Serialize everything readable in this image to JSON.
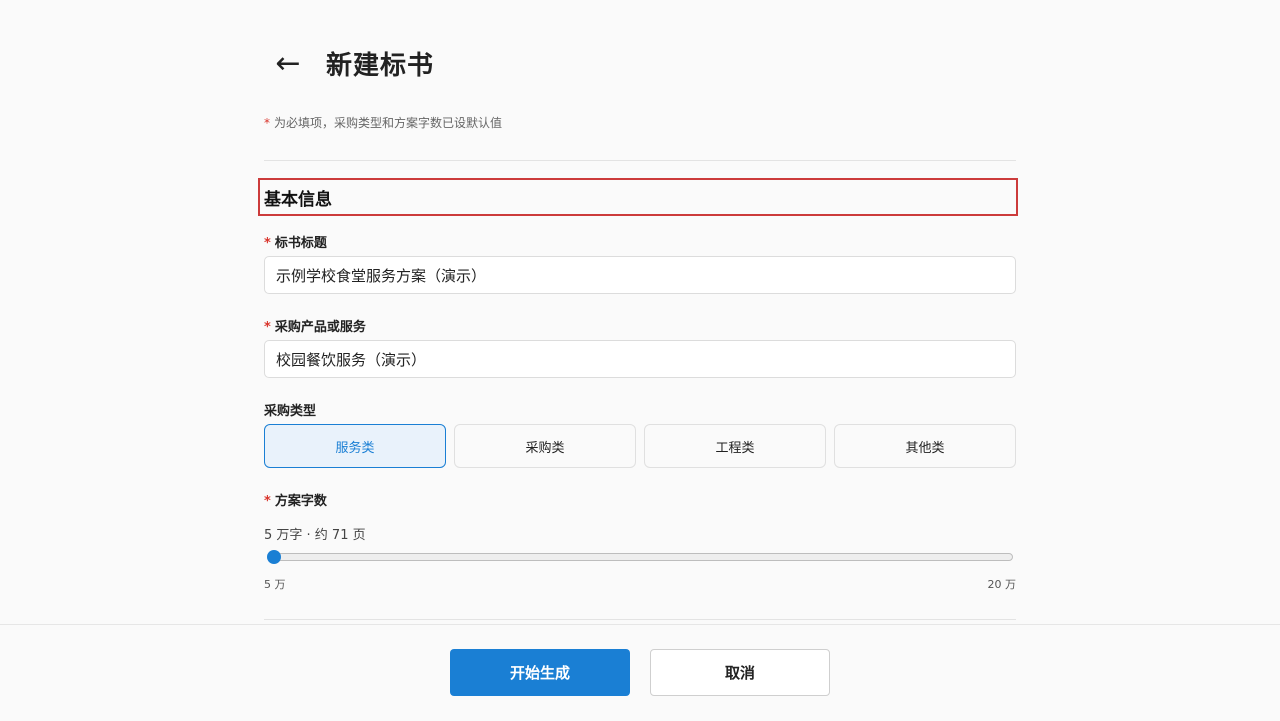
{
  "header": {
    "back_icon": "←",
    "title": "新建标书"
  },
  "hint": {
    "required_mark": "*",
    "text": "为必填项，采购类型和方案字数已设默认值"
  },
  "section": {
    "title": "基本信息"
  },
  "fields": {
    "bid_title": {
      "required_mark": "*",
      "label": "标书标题",
      "value": "示例学校食堂服务方案（演示）"
    },
    "product": {
      "required_mark": "*",
      "label": "采购产品或服务",
      "value": "校园餐饮服务（演示）"
    },
    "procurement_type": {
      "label": "采购类型",
      "options": [
        "服务类",
        "采购类",
        "工程类",
        "其他类"
      ],
      "selected": "服务类"
    },
    "word_count": {
      "required_mark": "*",
      "label": "方案字数",
      "display": "5 万字 · 约 71 页",
      "value": 5,
      "min_label": "5 万",
      "max_label": "20 万"
    }
  },
  "footer": {
    "start_label": "开始生成",
    "cancel_label": "取消"
  },
  "colors": {
    "accent": "#1a7fd4",
    "required": "#d9342b",
    "section_highlight": "#cc3b3b"
  }
}
